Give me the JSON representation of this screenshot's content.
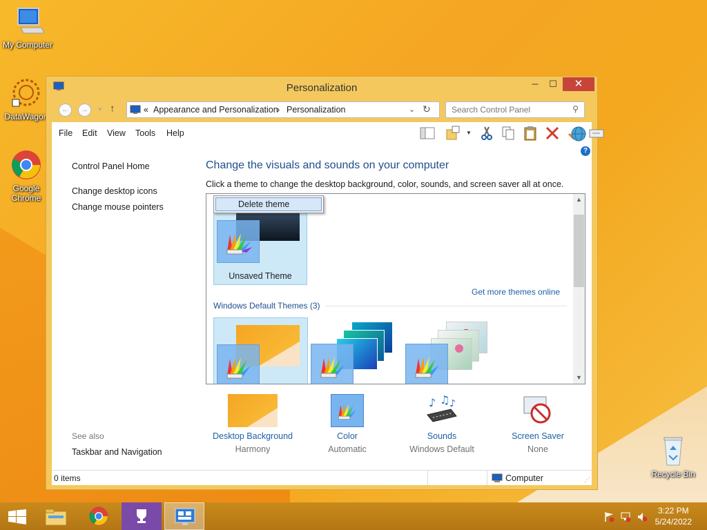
{
  "desktop": {
    "icons": [
      {
        "label": "My Computer",
        "icon": "computer-icon"
      },
      {
        "label": "DataWagon",
        "icon": "datawagon-icon"
      },
      {
        "label": "Google Chrome",
        "icon": "chrome-icon"
      },
      {
        "label": "Recycle Bin",
        "icon": "recycle-bin-icon"
      }
    ]
  },
  "window": {
    "title": "Personalization",
    "controls": {
      "minimize": "─",
      "maximize": "☐",
      "close": "✕"
    },
    "address": {
      "prefix": "«",
      "crumb1": "Appearance and Personalization",
      "sep": "›",
      "crumb2": "Personalization"
    },
    "search_placeholder": "Search Control Panel",
    "menus": [
      "File",
      "Edit",
      "View",
      "Tools",
      "Help"
    ],
    "sidebar": {
      "links": [
        "Control Panel Home",
        "Change desktop icons",
        "Change mouse pointers"
      ],
      "see_also_label": "See also",
      "see_also_links": [
        "Taskbar and Navigation"
      ]
    },
    "main": {
      "title": "Change the visuals and sounds on your computer",
      "subtitle": "Click a theme to change the desktop background, color, sounds, and screen saver all at once.",
      "context_menu_item": "Delete theme",
      "unsaved_theme_label": "Unsaved Theme",
      "more_themes_link": "Get more themes online",
      "group_label": "Windows Default Themes (3)"
    },
    "bottom": [
      {
        "label": "Desktop Background",
        "value": "Harmony",
        "icon": "desktop-background-icon"
      },
      {
        "label": "Color",
        "value": "Automatic",
        "icon": "color-icon"
      },
      {
        "label": "Sounds",
        "value": "Windows Default",
        "icon": "sounds-icon"
      },
      {
        "label": "Screen Saver",
        "value": "None",
        "icon": "screen-saver-icon"
      }
    ],
    "status": {
      "items": "0 items",
      "location": "Computer"
    }
  },
  "taskbar": {
    "time": "3:22 PM",
    "date": "5/24/2022"
  },
  "colors": {
    "accent": "#f4c85d",
    "link": "#1e5fa8",
    "heading": "#1e4e8c"
  }
}
